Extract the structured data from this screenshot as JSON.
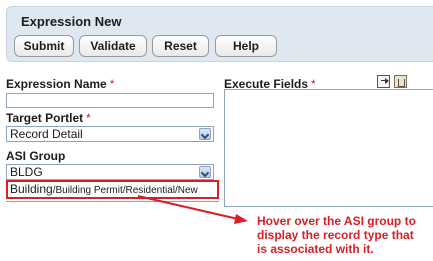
{
  "panel": {
    "title": "Expression New",
    "buttons": {
      "submit": "Submit",
      "validate": "Validate",
      "reset": "Reset",
      "help": "Help"
    }
  },
  "form": {
    "expression_name": {
      "label": "Expression Name",
      "value": ""
    },
    "target_portlet": {
      "label": "Target Portlet",
      "selected": "Record Detail"
    },
    "asi_group": {
      "label": "ASI Group",
      "selected": "BLDG",
      "tooltip_main": "Building",
      "tooltip_path": "/Building Permit/Residential/New"
    },
    "required_marker": "*"
  },
  "execute_fields": {
    "label": "Execute Fields",
    "icons": [
      "export-icon",
      "trash-icon"
    ]
  },
  "annotation": {
    "lines": [
      "Hover over the ASI group to",
      "display the record type that",
      "is associated with it."
    ]
  },
  "colors": {
    "panel_bg": "#dfe7f1",
    "required": "#d21e1e",
    "annotation": "#d61f26",
    "field_border": "#8fa3bd"
  }
}
